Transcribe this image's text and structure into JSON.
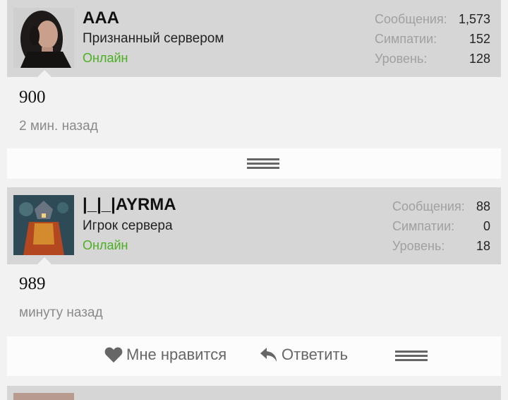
{
  "posts": [
    {
      "username": "AAA",
      "user_title": "Признанный сервером",
      "status": "Онлайн",
      "stats": [
        {
          "label": "Сообщения:",
          "value": "1,573"
        },
        {
          "label": "Симпатии:",
          "value": "152"
        },
        {
          "label": "Уровень:",
          "value": "128"
        }
      ],
      "message": "900",
      "time": "2 мин. назад"
    },
    {
      "username": "|_|_|AYRMA",
      "user_title": "Игрок сервера",
      "status": "Онлайн",
      "stats": [
        {
          "label": "Сообщения:",
          "value": "88"
        },
        {
          "label": "Симпатии:",
          "value": "0"
        },
        {
          "label": "Уровень:",
          "value": "18"
        }
      ],
      "message": "989",
      "time": "минуту назад"
    }
  ],
  "actions": {
    "like": "Мне нравится",
    "reply": "Ответить"
  },
  "icons": {
    "like": "heart-icon",
    "reply": "reply-arrow-icon",
    "menu": "hamburger-menu-icon"
  },
  "colors": {
    "online": "#4caf22",
    "header_bg": "#d6d6d6",
    "stat_label": "#a0a0a0"
  }
}
